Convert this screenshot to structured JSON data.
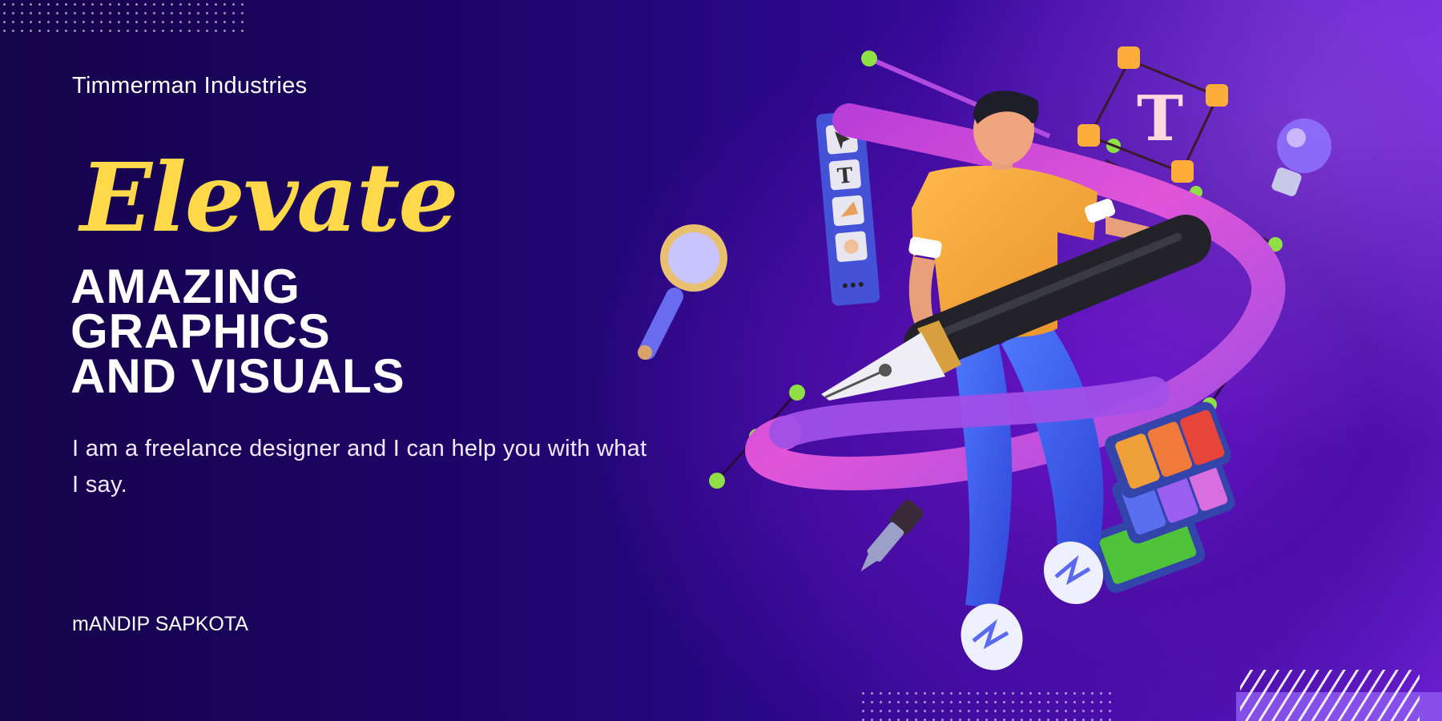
{
  "company_name": "Timmerman Industries",
  "headline": {
    "script_word": "Elevate",
    "lines": [
      "AMAZING",
      "GRAPHICS",
      "AND VISUALS"
    ]
  },
  "description": "I am a freelance designer and I can help you with what I say.",
  "author": "mANDIP SAPKOTA",
  "illustration": {
    "text_tool_glyph": "T",
    "icons": [
      "designer-figure",
      "pen-nib-icon",
      "magnifier-icon",
      "toolbar-icon",
      "lightbulb-icon",
      "eyedropper-icon",
      "swatches-icon",
      "text-frame-icon"
    ]
  },
  "colors": {
    "accent_yellow": "#ffd94a",
    "background_dark": "#14044a",
    "background_purple": "#6d22d6",
    "curve_pink": "#d44bd8",
    "node_green": "#8ee044"
  }
}
